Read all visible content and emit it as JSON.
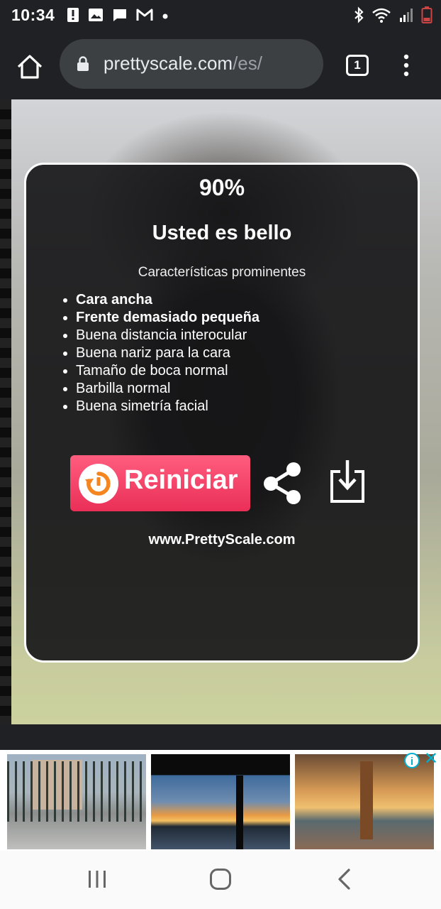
{
  "status_bar": {
    "time": "10:34",
    "left_icons": [
      "alert-icon",
      "image-icon",
      "message-icon",
      "gmail-icon",
      "dot-icon"
    ],
    "right_icons": [
      "bluetooth-icon",
      "wifi-icon",
      "signal-icon",
      "battery-icon"
    ]
  },
  "browser": {
    "url_domain": "prettyscale.com",
    "url_path": "/es/",
    "tab_count": "1"
  },
  "result": {
    "percent": "90%",
    "verdict": "Usted es bello",
    "features_title": "Características prominentes",
    "features": [
      {
        "text": "Cara ancha",
        "bold": true
      },
      {
        "text": "Frente demasiado pequeña",
        "bold": true
      },
      {
        "text": "Buena distancia interocular",
        "bold": false
      },
      {
        "text": "Buena nariz para la cara",
        "bold": false
      },
      {
        "text": "Tamaño de boca normal",
        "bold": false
      },
      {
        "text": "Barbilla normal",
        "bold": false
      },
      {
        "text": "Buena simetría facial",
        "bold": false
      }
    ],
    "reset_label": "Reiniciar",
    "site": "www.PrettyScale.com"
  },
  "colors": {
    "reset_button": "#f0395f",
    "reset_icon_accent": "#f5861f",
    "adchoices": "#00aecd",
    "browser_chrome": "#202124"
  }
}
